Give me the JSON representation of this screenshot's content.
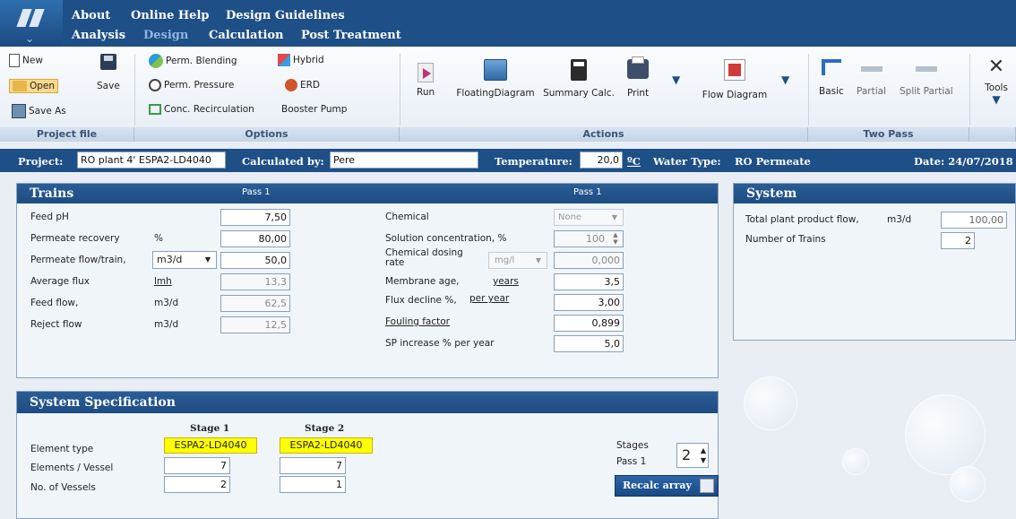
{
  "menu": {
    "row1": [
      "About",
      "Online Help",
      "Design Guidelines"
    ],
    "row2": [
      "Analysis",
      "Design",
      "Calculation",
      "Post Treatment"
    ]
  },
  "ribbon": {
    "project_file": {
      "label": "Project file",
      "new": "New",
      "open": "Open",
      "save": "Save",
      "save_as": "Save As"
    },
    "options": {
      "label": "Options",
      "perm_blending": "Perm. Blending",
      "hybrid": "Hybrid",
      "perm_pressure": "Perm. Pressure",
      "erd": "ERD",
      "conc_recirculation": "Conc. Recirculation",
      "booster_pump": "Booster Pump"
    },
    "actions": {
      "label": "Actions",
      "run": "Run",
      "floating_diagram": "FloatingDiagram",
      "summary_calc": "Summary Calc.",
      "print": "Print",
      "flow_diagram": "Flow Diagram"
    },
    "two_pass": {
      "label": "Two Pass",
      "basic": "Basic",
      "partial": "Partial",
      "split_partial": "Split Partial"
    },
    "tools": "Tools"
  },
  "project_bar": {
    "project_label": "Project:",
    "project_value": "RO plant 4' ESPA2-LD4040",
    "calc_by_label": "Calculated by:",
    "calc_by_value": "Pere",
    "temp_label": "Temperature:",
    "temp_value": "20,0",
    "temp_unit": "ºC",
    "water_type_label": "Water Type:",
    "water_type_value": "RO Permeate",
    "date": "Date:  24/07/2018"
  },
  "trains": {
    "title": "Trains",
    "pass_left": "Pass 1",
    "pass_right": "Pass 1",
    "rows": [
      {
        "label": "Feed pH",
        "unit": "",
        "value": "7,50"
      },
      {
        "label": "Permeate recovery",
        "unit": "%",
        "value": "80,00"
      },
      {
        "label": "Permeate flow/train,",
        "unit": "m3/d",
        "value": "50,0"
      },
      {
        "label": "Average flux",
        "unit": "lmh",
        "value": "13,3"
      },
      {
        "label": "Feed flow,",
        "unit": "m3/d",
        "value": "62,5"
      },
      {
        "label": "Reject flow",
        "unit": "m3/d",
        "value": "12,5"
      }
    ],
    "right_rows": {
      "chemical": "Chemical",
      "chemical_value": "None",
      "solution_conc": "Solution concentration, %",
      "solution_conc_value": "100",
      "dosing_rate": "Chemical dosing rate",
      "dosing_unit": "mg/l",
      "dosing_value": "0,000",
      "membrane_age": "Membrane age,",
      "membrane_age_unit": "years",
      "membrane_age_value": "3,5",
      "flux_decline": "Flux decline %,",
      "flux_decline_unit": "per year",
      "flux_decline_value": "3,00",
      "fouling": "Fouling factor",
      "fouling_value": "0,899",
      "sp_increase": "SP increase % per year",
      "sp_increase_value": "5,0"
    }
  },
  "system": {
    "title": "System",
    "total_flow": "Total plant product flow,",
    "total_flow_unit": "m3/d",
    "total_flow_value": "100,00",
    "num_trains": "Number of Trains",
    "num_trains_value": "2"
  },
  "spec": {
    "title": "System Specification",
    "stage1": "Stage 1",
    "stage2": "Stage 2",
    "element_type": "Element type",
    "elements_vessel": "Elements / Vessel",
    "vessels": "No. of Vessels",
    "s1_element": "ESPA2-LD4040",
    "s2_element": "ESPA2-LD4040",
    "s1_ev": "7",
    "s2_ev": "7",
    "s1_v": "2",
    "s2_v": "1",
    "stages_label": "Stages",
    "pass_label": "Pass 1",
    "stages_value": "2",
    "recalc": "Recalc array"
  },
  "colors": {
    "header_blue": "#1e4f86",
    "highlight_yellow": "#ffff00"
  }
}
